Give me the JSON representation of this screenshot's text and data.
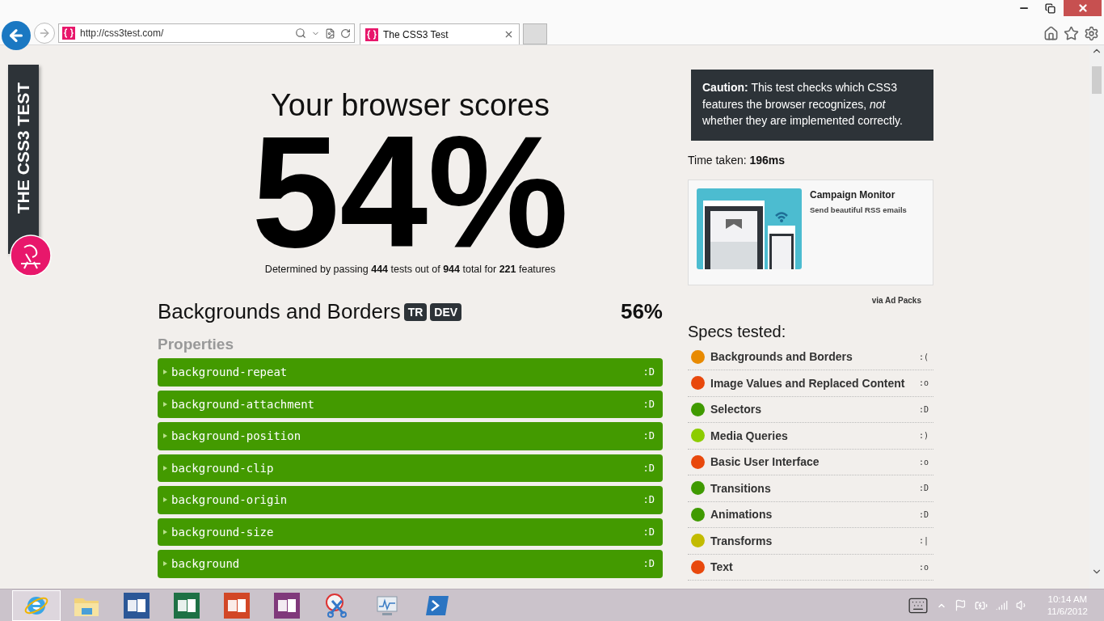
{
  "browser": {
    "url": "http://css3test.com/",
    "tabs": [
      {
        "title": "The CSS3 Test",
        "selected": true
      }
    ]
  },
  "side_tab": {
    "label": "THE CSS3 TEST"
  },
  "score": {
    "heading": "Your browser scores",
    "percent": "54%",
    "summary": "Determined by passing **444** tests out of **944** total for **221** features"
  },
  "section": {
    "title": "Backgrounds and Borders",
    "badges": [
      "TR",
      "DEV"
    ],
    "score": "56%",
    "subheading": "Properties",
    "items": [
      {
        "name": "background-repeat",
        "result": ":D",
        "passed": true
      },
      {
        "name": "background-attachment",
        "result": ":D",
        "passed": true
      },
      {
        "name": "background-position",
        "result": ":D",
        "passed": true
      },
      {
        "name": "background-clip",
        "result": ":D",
        "passed": true
      },
      {
        "name": "background-origin",
        "result": ":D",
        "passed": true
      },
      {
        "name": "background-size",
        "result": ":D",
        "passed": true
      },
      {
        "name": "background",
        "result": ":D",
        "passed": true
      }
    ]
  },
  "caution": "**Caution:** This test checks which CSS3 features the browser recognizes, *not* whether they are implemented correctly.",
  "time_taken": "Time taken: **196ms**",
  "ad": {
    "title": "Campaign Monitor",
    "text": "Send beautiful RSS emails",
    "via": "via Ad Packs"
  },
  "specs": {
    "title": "Specs tested:",
    "items": [
      {
        "name": "Backgrounds and Borders",
        "face": ":(",
        "color": "#e88a00"
      },
      {
        "name": "Image Values and Replaced Content",
        "face": ":o",
        "color": "#e8480c"
      },
      {
        "name": "Selectors",
        "face": ":D",
        "color": "#3f9a00"
      },
      {
        "name": "Media Queries",
        "face": ":)",
        "color": "#8ccc00"
      },
      {
        "name": "Basic User Interface",
        "face": ":o",
        "color": "#e8480c"
      },
      {
        "name": "Transitions",
        "face": ":D",
        "color": "#3f9a00"
      },
      {
        "name": "Animations",
        "face": ":D",
        "color": "#3f9a00"
      },
      {
        "name": "Transforms",
        "face": ":|",
        "color": "#c2bb00"
      },
      {
        "name": "Text",
        "face": ":o",
        "color": "#e8480c"
      }
    ]
  },
  "taskbar": {
    "apps": [
      {
        "kind": "browser",
        "selected": true
      },
      {
        "kind": "folder",
        "selected": false
      },
      {
        "kind": "word",
        "selected": false
      },
      {
        "kind": "excel",
        "selected": false
      },
      {
        "kind": "powerpoint",
        "selected": false
      },
      {
        "kind": "onenote",
        "selected": false
      },
      {
        "kind": "snipping",
        "selected": false
      },
      {
        "kind": "monitor",
        "selected": false
      },
      {
        "kind": "shell",
        "selected": false
      }
    ],
    "time": "10:14 AM",
    "date": "11/6/2012"
  }
}
